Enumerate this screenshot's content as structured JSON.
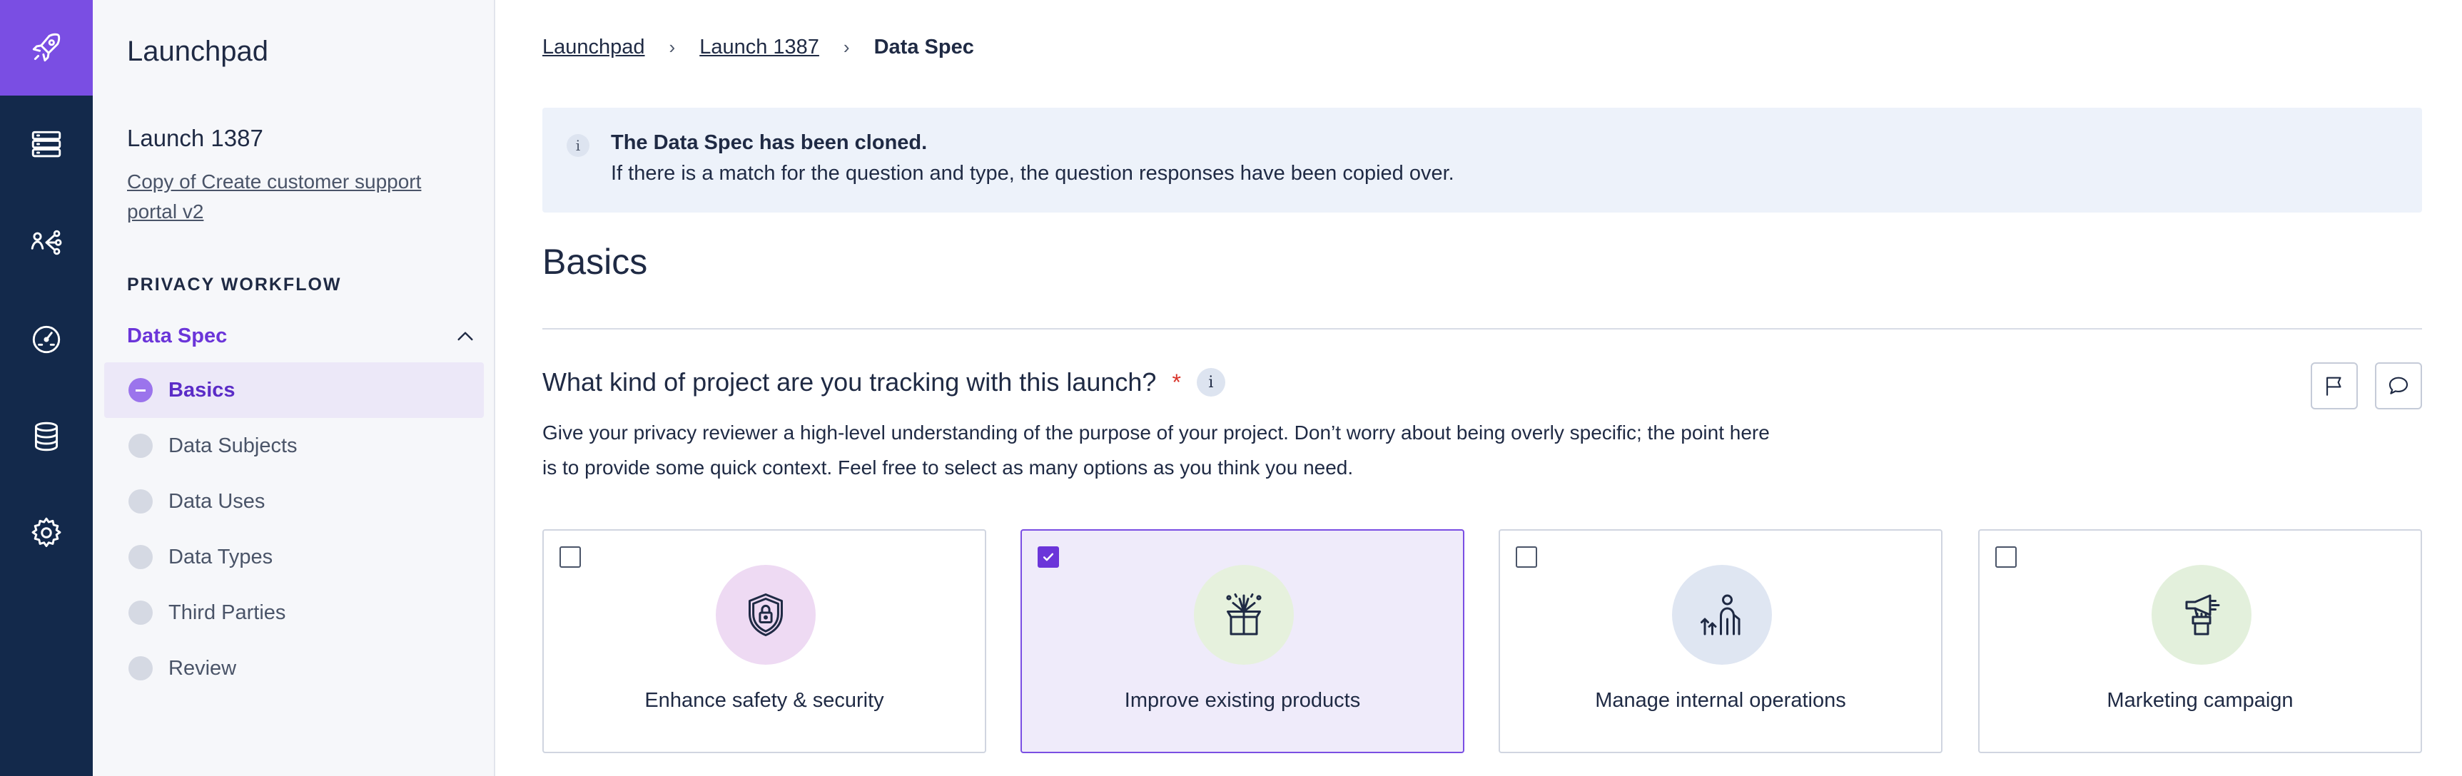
{
  "app": {
    "name": "Launchpad"
  },
  "colors": {
    "rail": "#13294b",
    "accent": "#7a4ee3",
    "required": "#d9342b"
  },
  "rail": {
    "icons": [
      "rocket-icon",
      "servers-icon",
      "data-flow-icon",
      "dashboard-gauge-icon",
      "database-icon",
      "gear-icon"
    ]
  },
  "sidebar": {
    "launch_title": "Launch 1387",
    "launch_link": "Copy of Create customer support portal v2",
    "section_label": "PRIVACY WORKFLOW",
    "group_label": "Data Spec",
    "steps": [
      {
        "label": "Basics",
        "active": true
      },
      {
        "label": "Data Subjects"
      },
      {
        "label": "Data Uses"
      },
      {
        "label": "Data Types"
      },
      {
        "label": "Third Parties"
      },
      {
        "label": "Review"
      }
    ]
  },
  "breadcrumb": [
    "Launchpad",
    "Launch 1387",
    "Data Spec"
  ],
  "breadcrumb_separator": "›",
  "banner": {
    "icon": "i",
    "title": "The Data Spec has been cloned.",
    "text": "If there is a match for the question and type, the question responses have been copied over."
  },
  "section": {
    "title": "Basics"
  },
  "question": {
    "text": "What kind of project are you tracking with this launch?",
    "required_mark": "*",
    "info_icon": "i",
    "description": "Give your privacy reviewer a high-level understanding of the purpose of your project. Don’t worry about being overly specific; the point here is to provide some quick context. Feel free to select as many options as you think you need.",
    "actions": [
      "flag-icon",
      "comment-icon"
    ]
  },
  "options": [
    {
      "label": "Enhance safety & security",
      "checked": false,
      "icon": "shield-lock-icon",
      "circle_color": "#eedaf3"
    },
    {
      "label": "Improve existing products",
      "checked": true,
      "icon": "gift-box-burst-icon",
      "circle_color": "#e6f1dd"
    },
    {
      "label": "Manage internal operations",
      "checked": false,
      "icon": "people-growth-icon",
      "circle_color": "#dfe6f2"
    },
    {
      "label": "Marketing campaign",
      "checked": false,
      "icon": "megaphone-hand-icon",
      "circle_color": "#e3f0dc"
    }
  ]
}
